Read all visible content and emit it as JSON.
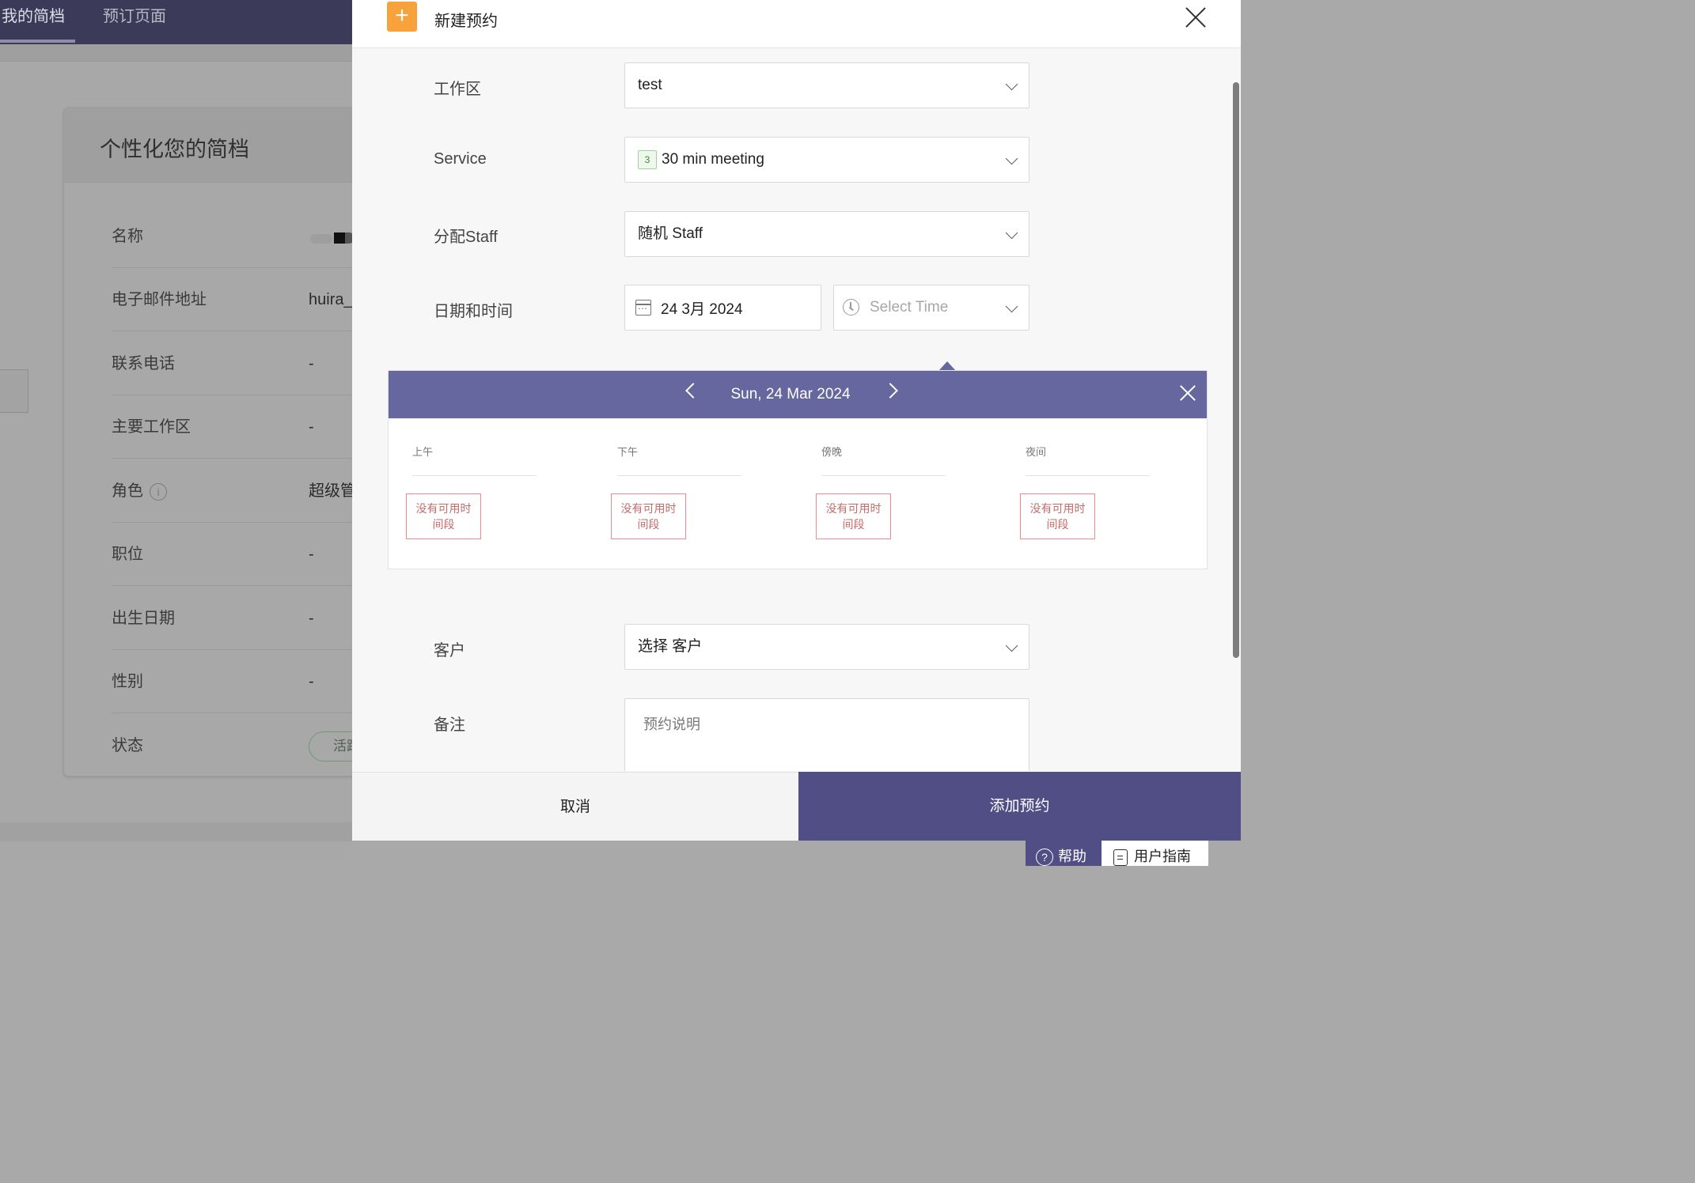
{
  "background_page": {
    "tabs": [
      {
        "label": "我的简档",
        "active": true
      },
      {
        "label": "预订页面",
        "active": false
      }
    ],
    "card_title": "个性化您的简档",
    "fields": [
      {
        "label": "名称",
        "value": ""
      },
      {
        "label": "电子邮件地址",
        "value": "huira_"
      },
      {
        "label": "联系电话",
        "value": "-"
      },
      {
        "label": "主要工作区",
        "value": "-"
      },
      {
        "label": "角色",
        "value": "超级管"
      },
      {
        "label": "职位",
        "value": "-"
      },
      {
        "label": "出生日期",
        "value": "-"
      },
      {
        "label": "性别",
        "value": "-"
      },
      {
        "label": "状态",
        "value": "活跃"
      }
    ],
    "info_icon_glyph": "i"
  },
  "modal": {
    "plus_glyph": "+",
    "title": "新建预约",
    "workspace": {
      "label": "工作区",
      "value": "test"
    },
    "service": {
      "label": "Service",
      "badge": "3",
      "value": "30 min meeting"
    },
    "staff": {
      "label": "分配Staff",
      "value": "随机 Staff"
    },
    "datetime": {
      "label": "日期和时间",
      "date": "24 3月 2024",
      "time_placeholder": "Select Time"
    },
    "calendar": {
      "date": "Sun, 24 Mar 2024",
      "periods": [
        {
          "name": "上午",
          "empty_line1": "没有可用时",
          "empty_line2": "间段"
        },
        {
          "name": "下午",
          "empty_line1": "没有可用时",
          "empty_line2": "间段"
        },
        {
          "name": "傍晚",
          "empty_line1": "没有可用时",
          "empty_line2": "间段"
        },
        {
          "name": "夜间",
          "empty_line1": "没有可用时",
          "empty_line2": "间段"
        }
      ]
    },
    "customer": {
      "label": "客户",
      "value": "选择 客户"
    },
    "notes": {
      "label": "备注",
      "placeholder": "预约说明"
    },
    "buttons": {
      "cancel": "取消",
      "add": "添加预约"
    }
  },
  "floating": {
    "help_glyph": "?",
    "help": "帮助",
    "guide": "用户指南"
  },
  "colors": {
    "accent": "#514e86",
    "calendar_bar": "#6767a0",
    "plus_orange": "#f7a23a",
    "empty_slot_border": "#f08a8a"
  }
}
